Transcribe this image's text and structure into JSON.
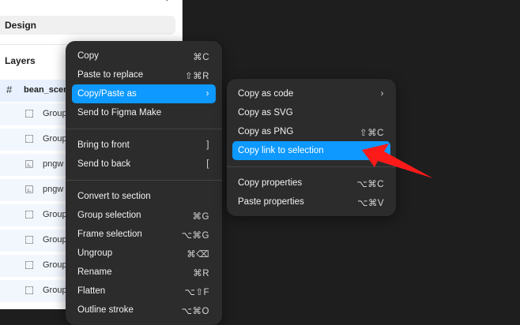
{
  "panel": {
    "top_label": "",
    "design_label": "Design",
    "layers_label": "Layers",
    "layers": [
      {
        "name": "bean_scene",
        "kind": "frame"
      },
      {
        "name": "Group",
        "kind": "group"
      },
      {
        "name": "Group",
        "kind": "group"
      },
      {
        "name": "pngw",
        "kind": "image"
      },
      {
        "name": "pngw",
        "kind": "image"
      },
      {
        "name": "Group",
        "kind": "group"
      },
      {
        "name": "Group",
        "kind": "group"
      },
      {
        "name": "Group",
        "kind": "group"
      },
      {
        "name": "Group",
        "kind": "group"
      }
    ]
  },
  "main_menu": {
    "items": [
      {
        "label": "Copy",
        "shortcut": "⌘C"
      },
      {
        "label": "Paste to replace",
        "shortcut": "⇧⌘R"
      },
      {
        "label": "Copy/Paste as",
        "shortcut": "›",
        "highlighted": true
      },
      {
        "label": "Send to Figma Make",
        "shortcut": ""
      },
      {
        "label": "Bring to front",
        "shortcut": "]"
      },
      {
        "label": "Send to back",
        "shortcut": "["
      },
      {
        "label": "Convert to section",
        "shortcut": ""
      },
      {
        "label": "Group selection",
        "shortcut": "⌘G"
      },
      {
        "label": "Frame selection",
        "shortcut": "⌥⌘G"
      },
      {
        "label": "Ungroup",
        "shortcut": "⌘⌫"
      },
      {
        "label": "Rename",
        "shortcut": "⌘R"
      },
      {
        "label": "Flatten",
        "shortcut": "⌥⇧F"
      },
      {
        "label": "Outline stroke",
        "shortcut": "⌥⌘O"
      }
    ]
  },
  "sub_menu": {
    "items": [
      {
        "label": "Copy as code",
        "shortcut": "›"
      },
      {
        "label": "Copy as SVG",
        "shortcut": ""
      },
      {
        "label": "Copy as PNG",
        "shortcut": "⇧⌘C"
      },
      {
        "label": "Copy link to selection",
        "shortcut": "",
        "highlighted": true
      },
      {
        "label": "Copy properties",
        "shortcut": "⌥⌘C"
      },
      {
        "label": "Paste properties",
        "shortcut": "⌥⌘V"
      }
    ]
  },
  "colors": {
    "canvas": "#1e1e1e",
    "menu_bg": "#2c2c2c",
    "highlight": "#0d99ff",
    "annotation_arrow": "#ff1a1a"
  }
}
